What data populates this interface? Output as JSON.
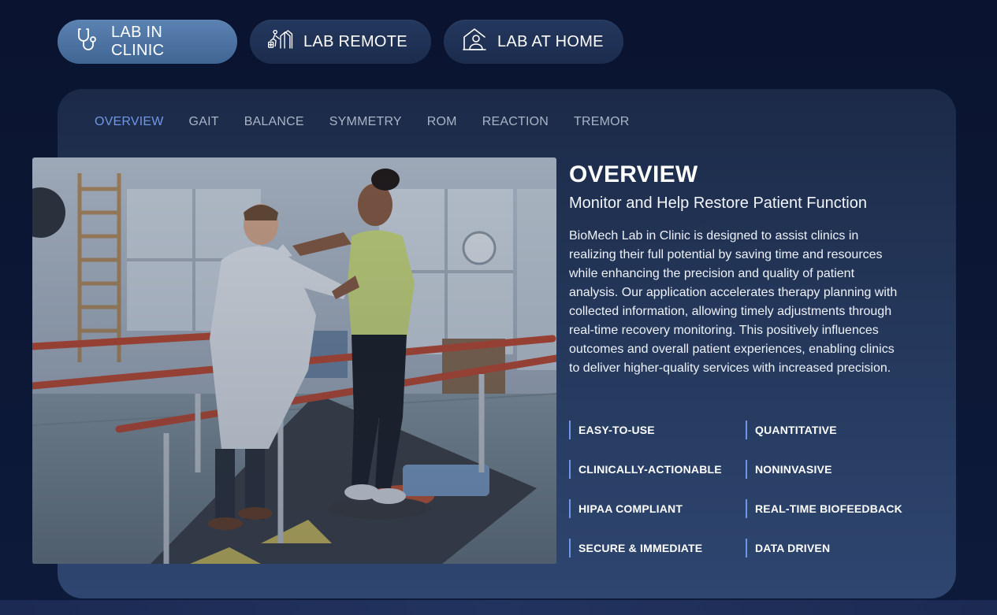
{
  "mode_tabs": [
    {
      "label": "LAB IN CLINIC",
      "icon": "stethoscope-icon",
      "active": true
    },
    {
      "label": "LAB REMOTE",
      "icon": "remote-patient-icon",
      "active": false
    },
    {
      "label": "LAB AT HOME",
      "icon": "home-user-icon",
      "active": false
    }
  ],
  "sub_tabs": [
    {
      "label": "OVERVIEW",
      "active": true
    },
    {
      "label": "GAIT",
      "active": false
    },
    {
      "label": "BALANCE",
      "active": false
    },
    {
      "label": "SYMMETRY",
      "active": false
    },
    {
      "label": "ROM",
      "active": false
    },
    {
      "label": "REACTION",
      "active": false
    },
    {
      "label": "TREMOR",
      "active": false
    }
  ],
  "content": {
    "title": "OVERVIEW",
    "subtitle": "Monitor and Help Restore Patient Function",
    "body": "BioMech Lab in Clinic is designed to assist clinics in realizing their full potential by saving time and resources while enhancing the precision and quality of patient analysis. Our application accelerates therapy planning with collected information, allowing timely adjustments through real-time recovery monitoring. This positively influences outcomes and overall patient experiences, enabling clinics to deliver higher-quality services with increased precision."
  },
  "features": [
    "EASY-TO-USE",
    "QUANTITATIVE",
    "CLINICALLY-ACTIONABLE",
    "NONINVASIVE",
    "HIPAA COMPLIANT",
    "REAL-TIME BIOFEEDBACK",
    "SECURE & IMMEDIATE",
    "DATA DRIVEN"
  ],
  "colors": {
    "accent": "#6f97e6",
    "active_tab": "#4f76a5",
    "panel": "#24375a",
    "background": "#0b1530"
  }
}
